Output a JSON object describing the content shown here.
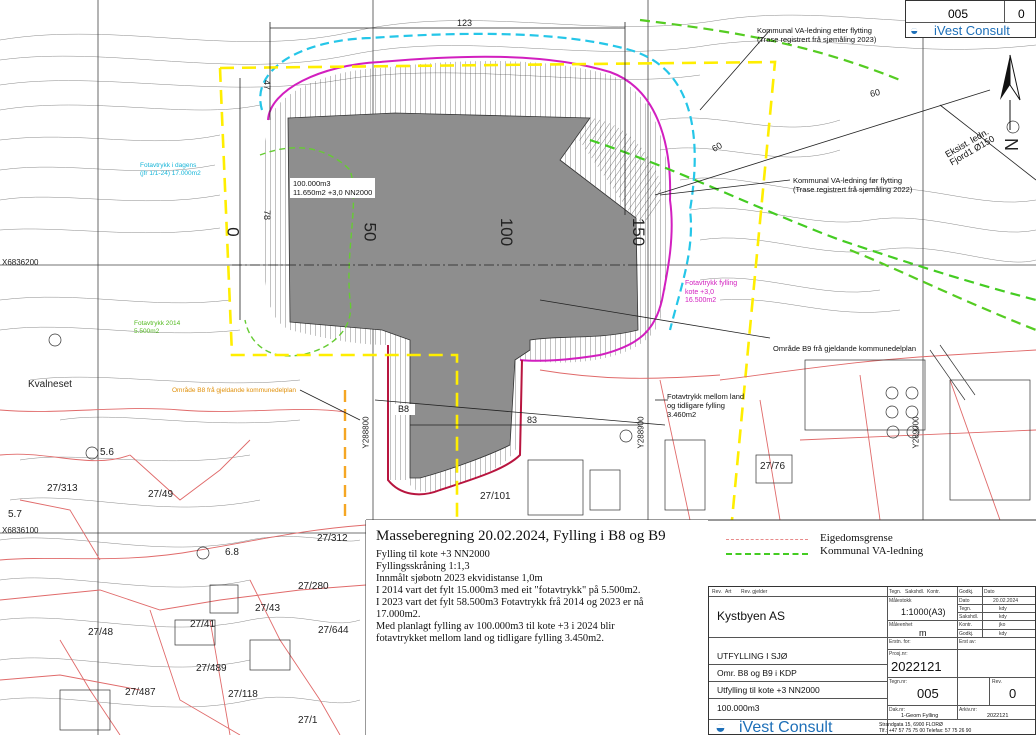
{
  "map": {
    "grid_labels": {
      "northing_upper": "X6836200",
      "northing_lower": "X6836100",
      "easting_left": "Y288800",
      "easting_right": "Y288900",
      "easting_far": "Y289000"
    },
    "chainage": [
      "0",
      "50",
      "100",
      "150"
    ],
    "dimensions": {
      "top_width": "123",
      "bottom_width": "83",
      "left_height_a": "47",
      "left_height_b": "78",
      "scale_60_a": "60",
      "scale_60_b": "60"
    },
    "place_name": "Kvalneset",
    "parcels": [
      "27/313",
      "27/49",
      "27/312",
      "27/280",
      "27/101",
      "27/76",
      "27/41",
      "27/43",
      "27/48",
      "27/487",
      "27/118",
      "27/489",
      "27/1",
      "5.6",
      "6.8",
      "5.7",
      "27/644"
    ],
    "annotations": {
      "volume_box": "100.000m3\n11.650m2 +3,0 NN2000",
      "b8_label": "B8",
      "va_after": "Kommunal VA-ledning etter flytting\n(Trase registrert frå sjømåling 2023)",
      "va_before": "Kommunal VA-ledning før flytting\n(Trase registrert frå sjømåling 2022)",
      "existing_pipe": "Eksist. ledn.\nFjord1 Ø150",
      "footprint_today": "Fotavtrykk i dagens\n(jfr 1/1-24) 17.000m2",
      "footprint_2014": "Fotavtrykk 2014\n5.500m2",
      "footprint_fill": "Fotavtrykk fylling\nkote +3,0\n16.500m2",
      "area_b9": "Område B9 frå gjeldande kommunedelplan",
      "area_b8": "Område B8 frå gjeldande kommunedelplan",
      "footprint_between": "Fotavtrykk mellom land\nog tidligare fylling\n3.460m2"
    },
    "north_arrow": "N"
  },
  "notes": {
    "title": "Masseberegning 20.02.2024, Fylling i B8 og B9",
    "lines": [
      "Fylling til kote +3 NN2000",
      "Fyllingsskråning 1:1,3",
      "Innmålt sjøbotn 2023 ekvidistanse 1,0m",
      "I 2014 vart det fylt 15.000m3 med eit \"fotavtrykk\" på 5.500m2.",
      "I 2023 vart det fylt 58.500m3 Fotavtrykk frå 2014 og 2023 er nå",
      "17.000m2.",
      "Med planlagt fylling av 100.000m3 til kote +3 i 2024 blir",
      "fotavtrykket mellom land og tidligare fylling 3.450m2."
    ]
  },
  "legend": {
    "items": [
      {
        "label": "Eigedomsgrense",
        "color": "#e88a8a",
        "style": "dashed"
      },
      {
        "label": "Kommunal VA-ledning",
        "color": "#44cc22",
        "style": "dashed"
      }
    ]
  },
  "title_block": {
    "headers": [
      "Rev.",
      "Art",
      "Rev. gjelder",
      "Tegn.",
      "Sakshdl.",
      "Kontr.",
      "Godkj.",
      "Dato"
    ],
    "client": "Kystbyen AS",
    "scale_label": "Målestokk",
    "scale": "1:1000(A3)",
    "unit_label": "Måleenhet",
    "unit": "m",
    "side_rows": [
      {
        "label": "Dato",
        "value": "20.02.2024"
      },
      {
        "label": "Tegn.",
        "value": "kdy"
      },
      {
        "label": "Sakshdl.",
        "value": "kdy"
      },
      {
        "label": "Kontr.",
        "value": "jko"
      },
      {
        "label": "Godkj.",
        "value": "kdy"
      }
    ],
    "project_lines": [
      "UTFYLLING I SJØ",
      "Omr. B8 og B9 i KDP",
      "Utfylling til kote +3 NN2000",
      "100.000m3"
    ],
    "erstatter_label": "Erstn. for:",
    "erstattet_label": "Erst av:",
    "project_no_label": "Prosj.nr:",
    "project_no": "2022121",
    "drawing_label": "Tegn.nr:",
    "drawing_no": "005",
    "rev_label": "Rev.",
    "rev": "0",
    "file_label": "Dak.nr:",
    "file": "1-Geom Fylling",
    "archive_label": "Arkiv.nr:",
    "archive": "2022121",
    "company": "iVest Consult",
    "address": "Strandgata 15,  6900 FLORØ\nTlf.: +47 57 75 75 00  Telefax: 57 75 26 90"
  },
  "top_box": {
    "drawing_no": "005",
    "rev": "0",
    "company": "iVest Consult"
  }
}
